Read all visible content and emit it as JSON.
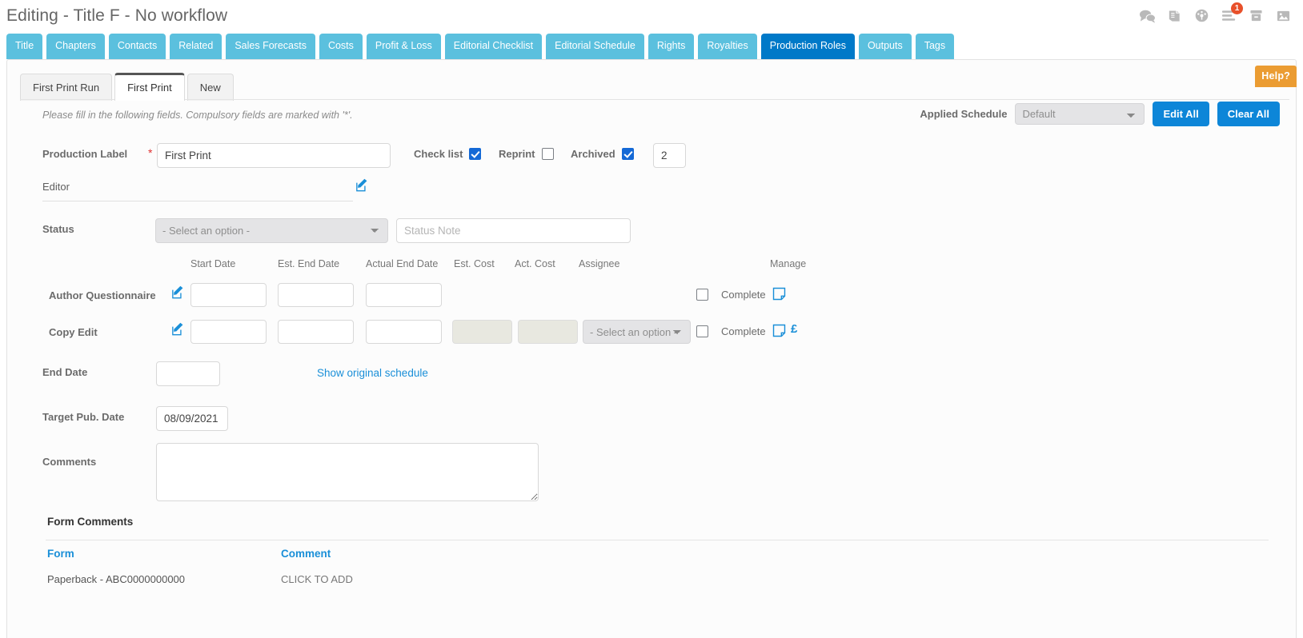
{
  "header": {
    "title": "Editing - Title F - No workflow",
    "icons": [
      {
        "name": "comments-icon",
        "badge": null
      },
      {
        "name": "book-icon",
        "badge": null
      },
      {
        "name": "dashboard-icon",
        "badge": null
      },
      {
        "name": "list-icon",
        "badge": "1"
      },
      {
        "name": "archive-icon",
        "badge": null
      },
      {
        "name": "image-icon",
        "badge": null
      }
    ]
  },
  "tabs": [
    {
      "label": "Title",
      "active": false
    },
    {
      "label": "Chapters",
      "active": false
    },
    {
      "label": "Contacts",
      "active": false
    },
    {
      "label": "Related",
      "active": false
    },
    {
      "label": "Sales Forecasts",
      "active": false
    },
    {
      "label": "Costs",
      "active": false
    },
    {
      "label": "Profit & Loss",
      "active": false
    },
    {
      "label": "Editorial Checklist",
      "active": false
    },
    {
      "label": "Editorial Schedule",
      "active": false
    },
    {
      "label": "Rights",
      "active": false
    },
    {
      "label": "Royalties",
      "active": false
    },
    {
      "label": "Production Roles",
      "active": true
    },
    {
      "label": "Outputs",
      "active": false
    },
    {
      "label": "Tags",
      "active": false
    }
  ],
  "help_label": "Help?",
  "subtabs": [
    {
      "label": "First Print Run",
      "active": false
    },
    {
      "label": "First Print",
      "active": true
    },
    {
      "label": "New",
      "active": false
    }
  ],
  "form": {
    "hint": "Please fill in the following fields. Compulsory fields are marked with '*'.",
    "production_label": {
      "label": "Production Label",
      "value": "First Print",
      "required": "*"
    },
    "checkboxes": [
      {
        "label": "Check list",
        "checked": true
      },
      {
        "label": "Reprint",
        "checked": false
      },
      {
        "label": "Archived",
        "checked": true
      }
    ],
    "count_value": "2",
    "editor": {
      "label": "Editor",
      "value": ""
    },
    "status": {
      "label": "Status",
      "selected": "- Select an option -",
      "note_placeholder": "Status Note"
    },
    "end_date": {
      "label": "End Date",
      "value": ""
    },
    "show_original_schedule": "Show original schedule",
    "target_pub_date": {
      "label": "Target Pub. Date",
      "value": "08/09/2021"
    },
    "comments": {
      "label": "Comments",
      "value": ""
    }
  },
  "applied_schedule": {
    "label": "Applied Schedule",
    "selected": "Default",
    "edit_all": "Edit All",
    "clear_all": "Clear All"
  },
  "schedule_table": {
    "columns": [
      "Start Date",
      "Est. End Date",
      "Actual End Date",
      "Est. Cost",
      "Act. Cost",
      "Assignee",
      "Manage"
    ],
    "rows": [
      {
        "name": "Author Questionnaire",
        "start_date": "",
        "est_end_date": "",
        "actual_end_date": "",
        "est_cost": null,
        "act_cost": null,
        "assignee": null,
        "complete_label": "Complete",
        "complete_checked": false,
        "has_currency": false
      },
      {
        "name": "Copy Edit",
        "start_date": "",
        "est_end_date": "",
        "actual_end_date": "",
        "est_cost": "",
        "act_cost": "",
        "assignee": "- Select an option -",
        "complete_label": "Complete",
        "complete_checked": false,
        "has_currency": true,
        "currency_symbol": "£"
      }
    ]
  },
  "form_comments": {
    "title": "Form Comments",
    "columns": [
      "Form",
      "Comment"
    ],
    "rows": [
      {
        "form": "Paperback - ABC0000000000",
        "comment": "CLICK TO ADD"
      }
    ]
  },
  "colors": {
    "tab": "#5bc0de",
    "tab_active": "#0079c8",
    "accent": "#1a8fd8",
    "help": "#eb9c32",
    "badge": "#e8502a",
    "required": "#e03131"
  }
}
